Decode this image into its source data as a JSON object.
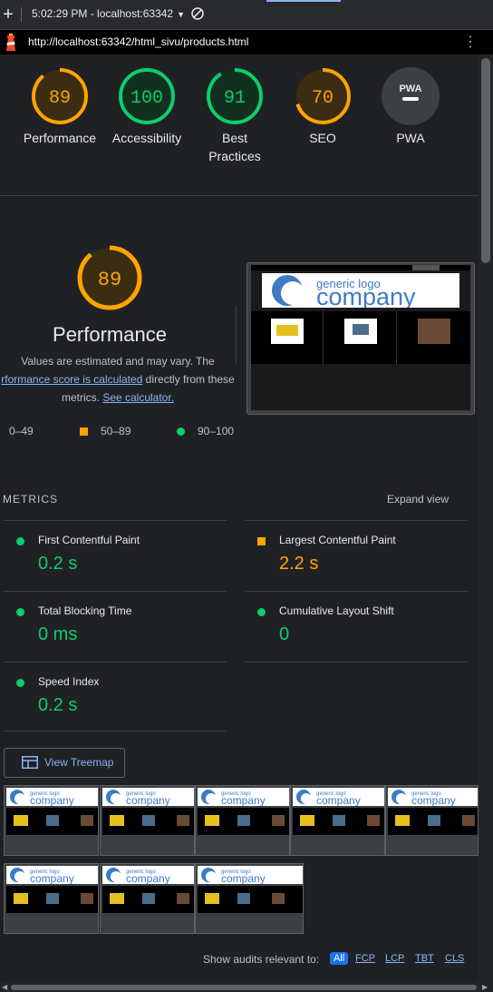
{
  "devtools": {
    "session_label": "5:02:29 PM - localhost:63342",
    "new_report_icon": "plus-icon",
    "clear_icon": "block-icon"
  },
  "urlbar": {
    "url": "http://localhost:63342/html_sivu/products.html",
    "lighthouse_icon": "lighthouse-icon",
    "menu_icon": "kebab-icon"
  },
  "categories": [
    {
      "label": "Performance",
      "score": "89",
      "score_value": 89,
      "color": "#ffa400"
    },
    {
      "label": "Accessibility",
      "score": "100",
      "score_value": 100,
      "color": "#0cce6b"
    },
    {
      "label_line1": "Best",
      "label_line2": "Practices",
      "score": "91",
      "score_value": 91,
      "color": "#0cce6b"
    },
    {
      "label": "SEO",
      "score": "70",
      "score_value": 70,
      "color": "#ffa400"
    },
    {
      "label": "PWA",
      "badge": "PWA"
    }
  ],
  "performance": {
    "score": "89",
    "score_value": 89,
    "title": "Performance",
    "desc_line1": "Values are estimated and may vary. The",
    "desc_link": "rformance score is calculated",
    "desc_mid": " directly from these",
    "desc_line3_a": "metrics. ",
    "desc_link2": "See calculator.",
    "legend": {
      "low": "0–49",
      "mid": "50–89",
      "high": "90–100"
    }
  },
  "page_screenshot": {
    "logo_text_top": "generic logo",
    "logo_text_bottom": "company"
  },
  "metrics": {
    "heading": "METRICS",
    "expand_label": "Expand view",
    "items": [
      {
        "title": "First Contentful Paint",
        "value": "0.2 s",
        "status": "pass"
      },
      {
        "title": "Largest Contentful Paint",
        "value": "2.2 s",
        "status": "average"
      },
      {
        "title": "Total Blocking Time",
        "value": "0 ms",
        "status": "pass"
      },
      {
        "title": "Cumulative Layout Shift",
        "value": "0",
        "status": "pass"
      },
      {
        "title": "Speed Index",
        "value": "0.2 s",
        "status": "pass"
      }
    ]
  },
  "treemap": {
    "label": "View Treemap"
  },
  "filmstrip": {
    "logo_text_top": "generic logo",
    "logo_text_bottom": "company",
    "frame_count": 8
  },
  "audit_filter": {
    "label": "Show audits relevant to:",
    "chips": [
      "All",
      "FCP",
      "LCP",
      "TBT",
      "CLS"
    ]
  },
  "colors": {
    "pass": "#0cce6b",
    "average": "#ffa400",
    "fail": "#ff4e42",
    "link": "#8ab4f8"
  }
}
